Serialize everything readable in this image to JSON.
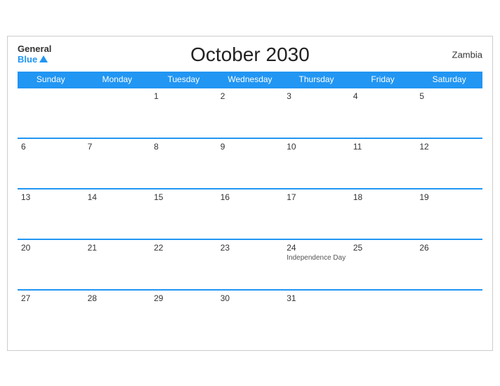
{
  "header": {
    "logo_general": "General",
    "logo_blue": "Blue",
    "title": "October 2030",
    "country": "Zambia"
  },
  "days_of_week": [
    "Sunday",
    "Monday",
    "Tuesday",
    "Wednesday",
    "Thursday",
    "Friday",
    "Saturday"
  ],
  "weeks": [
    [
      {
        "day": "",
        "empty": true
      },
      {
        "day": "",
        "empty": true
      },
      {
        "day": "1",
        "empty": false,
        "event": ""
      },
      {
        "day": "2",
        "empty": false,
        "event": ""
      },
      {
        "day": "3",
        "empty": false,
        "event": ""
      },
      {
        "day": "4",
        "empty": false,
        "event": ""
      },
      {
        "day": "5",
        "empty": false,
        "event": ""
      }
    ],
    [
      {
        "day": "6",
        "empty": false,
        "event": ""
      },
      {
        "day": "7",
        "empty": false,
        "event": ""
      },
      {
        "day": "8",
        "empty": false,
        "event": ""
      },
      {
        "day": "9",
        "empty": false,
        "event": ""
      },
      {
        "day": "10",
        "empty": false,
        "event": ""
      },
      {
        "day": "11",
        "empty": false,
        "event": ""
      },
      {
        "day": "12",
        "empty": false,
        "event": ""
      }
    ],
    [
      {
        "day": "13",
        "empty": false,
        "event": ""
      },
      {
        "day": "14",
        "empty": false,
        "event": ""
      },
      {
        "day": "15",
        "empty": false,
        "event": ""
      },
      {
        "day": "16",
        "empty": false,
        "event": ""
      },
      {
        "day": "17",
        "empty": false,
        "event": ""
      },
      {
        "day": "18",
        "empty": false,
        "event": ""
      },
      {
        "day": "19",
        "empty": false,
        "event": ""
      }
    ],
    [
      {
        "day": "20",
        "empty": false,
        "event": ""
      },
      {
        "day": "21",
        "empty": false,
        "event": ""
      },
      {
        "day": "22",
        "empty": false,
        "event": ""
      },
      {
        "day": "23",
        "empty": false,
        "event": ""
      },
      {
        "day": "24",
        "empty": false,
        "event": "Independence Day"
      },
      {
        "day": "25",
        "empty": false,
        "event": ""
      },
      {
        "day": "26",
        "empty": false,
        "event": ""
      }
    ],
    [
      {
        "day": "27",
        "empty": false,
        "event": ""
      },
      {
        "day": "28",
        "empty": false,
        "event": ""
      },
      {
        "day": "29",
        "empty": false,
        "event": ""
      },
      {
        "day": "30",
        "empty": false,
        "event": ""
      },
      {
        "day": "31",
        "empty": false,
        "event": ""
      },
      {
        "day": "",
        "empty": true
      },
      {
        "day": "",
        "empty": true
      }
    ]
  ]
}
